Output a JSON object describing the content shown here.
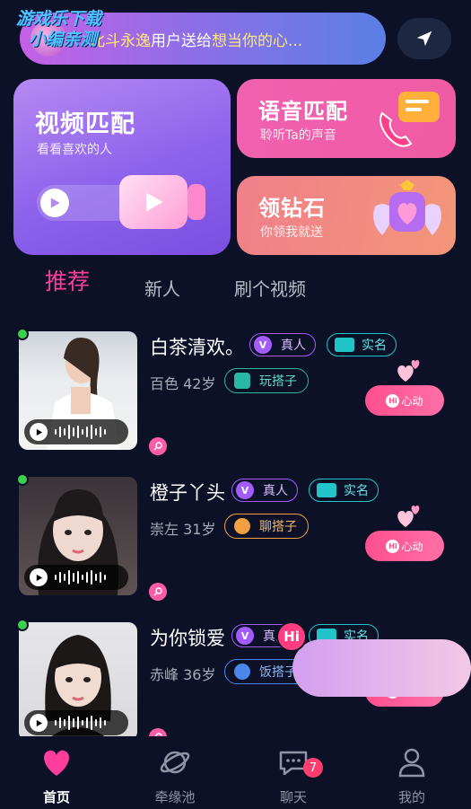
{
  "watermark": {
    "line1": "游戏乐下载",
    "line2": "小编亲测"
  },
  "marquee": {
    "prefix": "北斗永逸",
    "middle": "用户送给",
    "highlight": "想当你的心..."
  },
  "locate_button": {
    "icon": "location-arrow-icon"
  },
  "feature_cards": {
    "video_match": {
      "title": "视频匹配",
      "subtitle": "看看喜欢的人"
    },
    "voice_match": {
      "title": "语音匹配",
      "subtitle": "聆听Ta的声音"
    },
    "diamond": {
      "title": "领钻石",
      "subtitle": "你领我就送"
    }
  },
  "tabs": [
    {
      "label": "推荐",
      "active": true
    },
    {
      "label": "新人",
      "active": false
    },
    {
      "label": "刷个视频",
      "active": false
    }
  ],
  "users": [
    {
      "name": "白茶清欢。",
      "real_badge": "真人",
      "verify_badge": "实名",
      "info": "百色 42岁",
      "hobby": "玩搭子",
      "like_label": "心动"
    },
    {
      "name": "橙子丫头",
      "real_badge": "真人",
      "verify_badge": "实名",
      "info": "崇左 31岁",
      "hobby": "聊搭子",
      "like_label": "心动"
    },
    {
      "name": "为你锁爱",
      "real_badge": "真人",
      "verify_badge": "实名",
      "info": "赤峰 36岁",
      "hobby": "饭搭子",
      "like_label": "心动"
    }
  ],
  "hi_bubble": {
    "label": "Hi"
  },
  "like_icon_label": "Hi",
  "tabbar": [
    {
      "label": "首页",
      "icon": "heart-icon",
      "active": true
    },
    {
      "label": "牵缘池",
      "icon": "planet-icon",
      "active": false
    },
    {
      "label": "聊天",
      "icon": "chat-icon",
      "active": false,
      "badge": "7"
    },
    {
      "label": "我的",
      "icon": "profile-icon",
      "active": false
    }
  ],
  "colors": {
    "accent_pink": "#ff3d9b",
    "background": "#0c1127",
    "online": "#3ad24d"
  }
}
